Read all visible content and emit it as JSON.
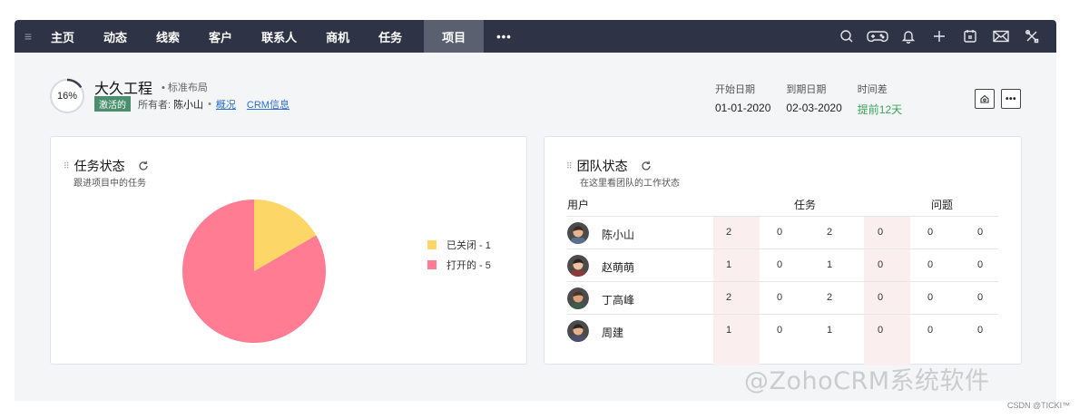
{
  "nav": {
    "items": [
      "主页",
      "动态",
      "线索",
      "客户",
      "联系人",
      "商机",
      "任务"
    ],
    "active": "项目",
    "more": "•••"
  },
  "project": {
    "progress": "16%",
    "progress_value": 0.16,
    "title": "大久工程",
    "layout": "• 标准布局",
    "status": "激活的",
    "owner_label": "所有者:",
    "owner": "陈小山",
    "link_overview": "概况",
    "link_crm": "CRM信息"
  },
  "dates": {
    "start_label": "开始日期",
    "start_value": "01-01-2020",
    "due_label": "到期日期",
    "due_value": "02-03-2020",
    "diff_label": "时间差",
    "diff_value": "提前12天"
  },
  "task_status": {
    "title": "任务状态",
    "subtitle": "跟进项目中的任务",
    "legend": [
      {
        "label": "已关闭 - 1",
        "color": "#fcd667"
      },
      {
        "label": "打开的 - 5",
        "color": "#ff7c93"
      }
    ]
  },
  "chart_data": {
    "type": "pie",
    "categories": [
      "已关闭",
      "打开的"
    ],
    "values": [
      1,
      5
    ],
    "colors": [
      "#fcd667",
      "#ff7c93"
    ]
  },
  "team_status": {
    "title": "团队状态",
    "subtitle": "在这里看团队的工作状态",
    "col_user": "用户",
    "col_task": "任务",
    "col_issue": "问题",
    "rows": [
      {
        "name": "陈小山",
        "values": [
          "2",
          "0",
          "2",
          "0",
          "0",
          "0"
        ]
      },
      {
        "name": "赵萌萌",
        "values": [
          "1",
          "0",
          "1",
          "0",
          "0",
          "0"
        ]
      },
      {
        "name": "丁高峰",
        "values": [
          "2",
          "0",
          "2",
          "0",
          "0",
          "0"
        ]
      },
      {
        "name": "周建",
        "values": [
          "1",
          "0",
          "1",
          "0",
          "0",
          "0"
        ]
      }
    ]
  },
  "watermark": "@ZohoCRM系统软件",
  "csdn": "CSDN @TICKI™"
}
